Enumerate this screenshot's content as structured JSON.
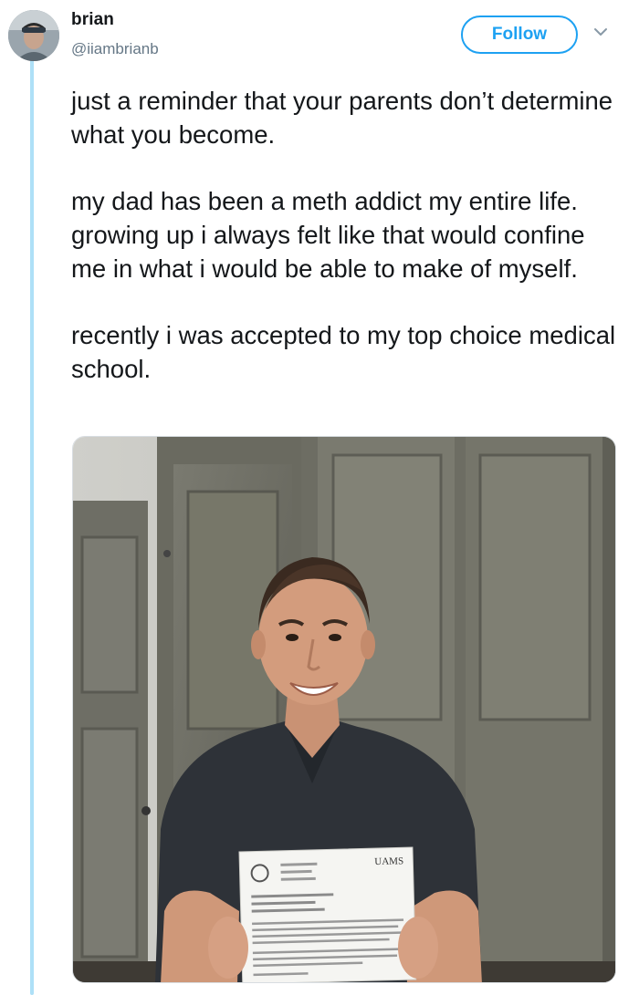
{
  "user": {
    "name": "brian",
    "handle": "@iiambrianb"
  },
  "actions": {
    "follow_label": "Follow"
  },
  "tweet": {
    "paragraphs": [
      "just a reminder that your parents don’t determine what you become.",
      "my dad has been a meth addict my entire life. growing up i always felt like that would confine me in what i would be able to make of myself.",
      "recently i was accepted to my top choice medical school."
    ]
  },
  "photo": {
    "letter_header": "UAMS"
  },
  "colors": {
    "accent": "#1da1f2",
    "thread_line": "#aee0f7",
    "secondary_text": "#657786"
  },
  "icons": {
    "menu": "chevron-down-icon"
  }
}
